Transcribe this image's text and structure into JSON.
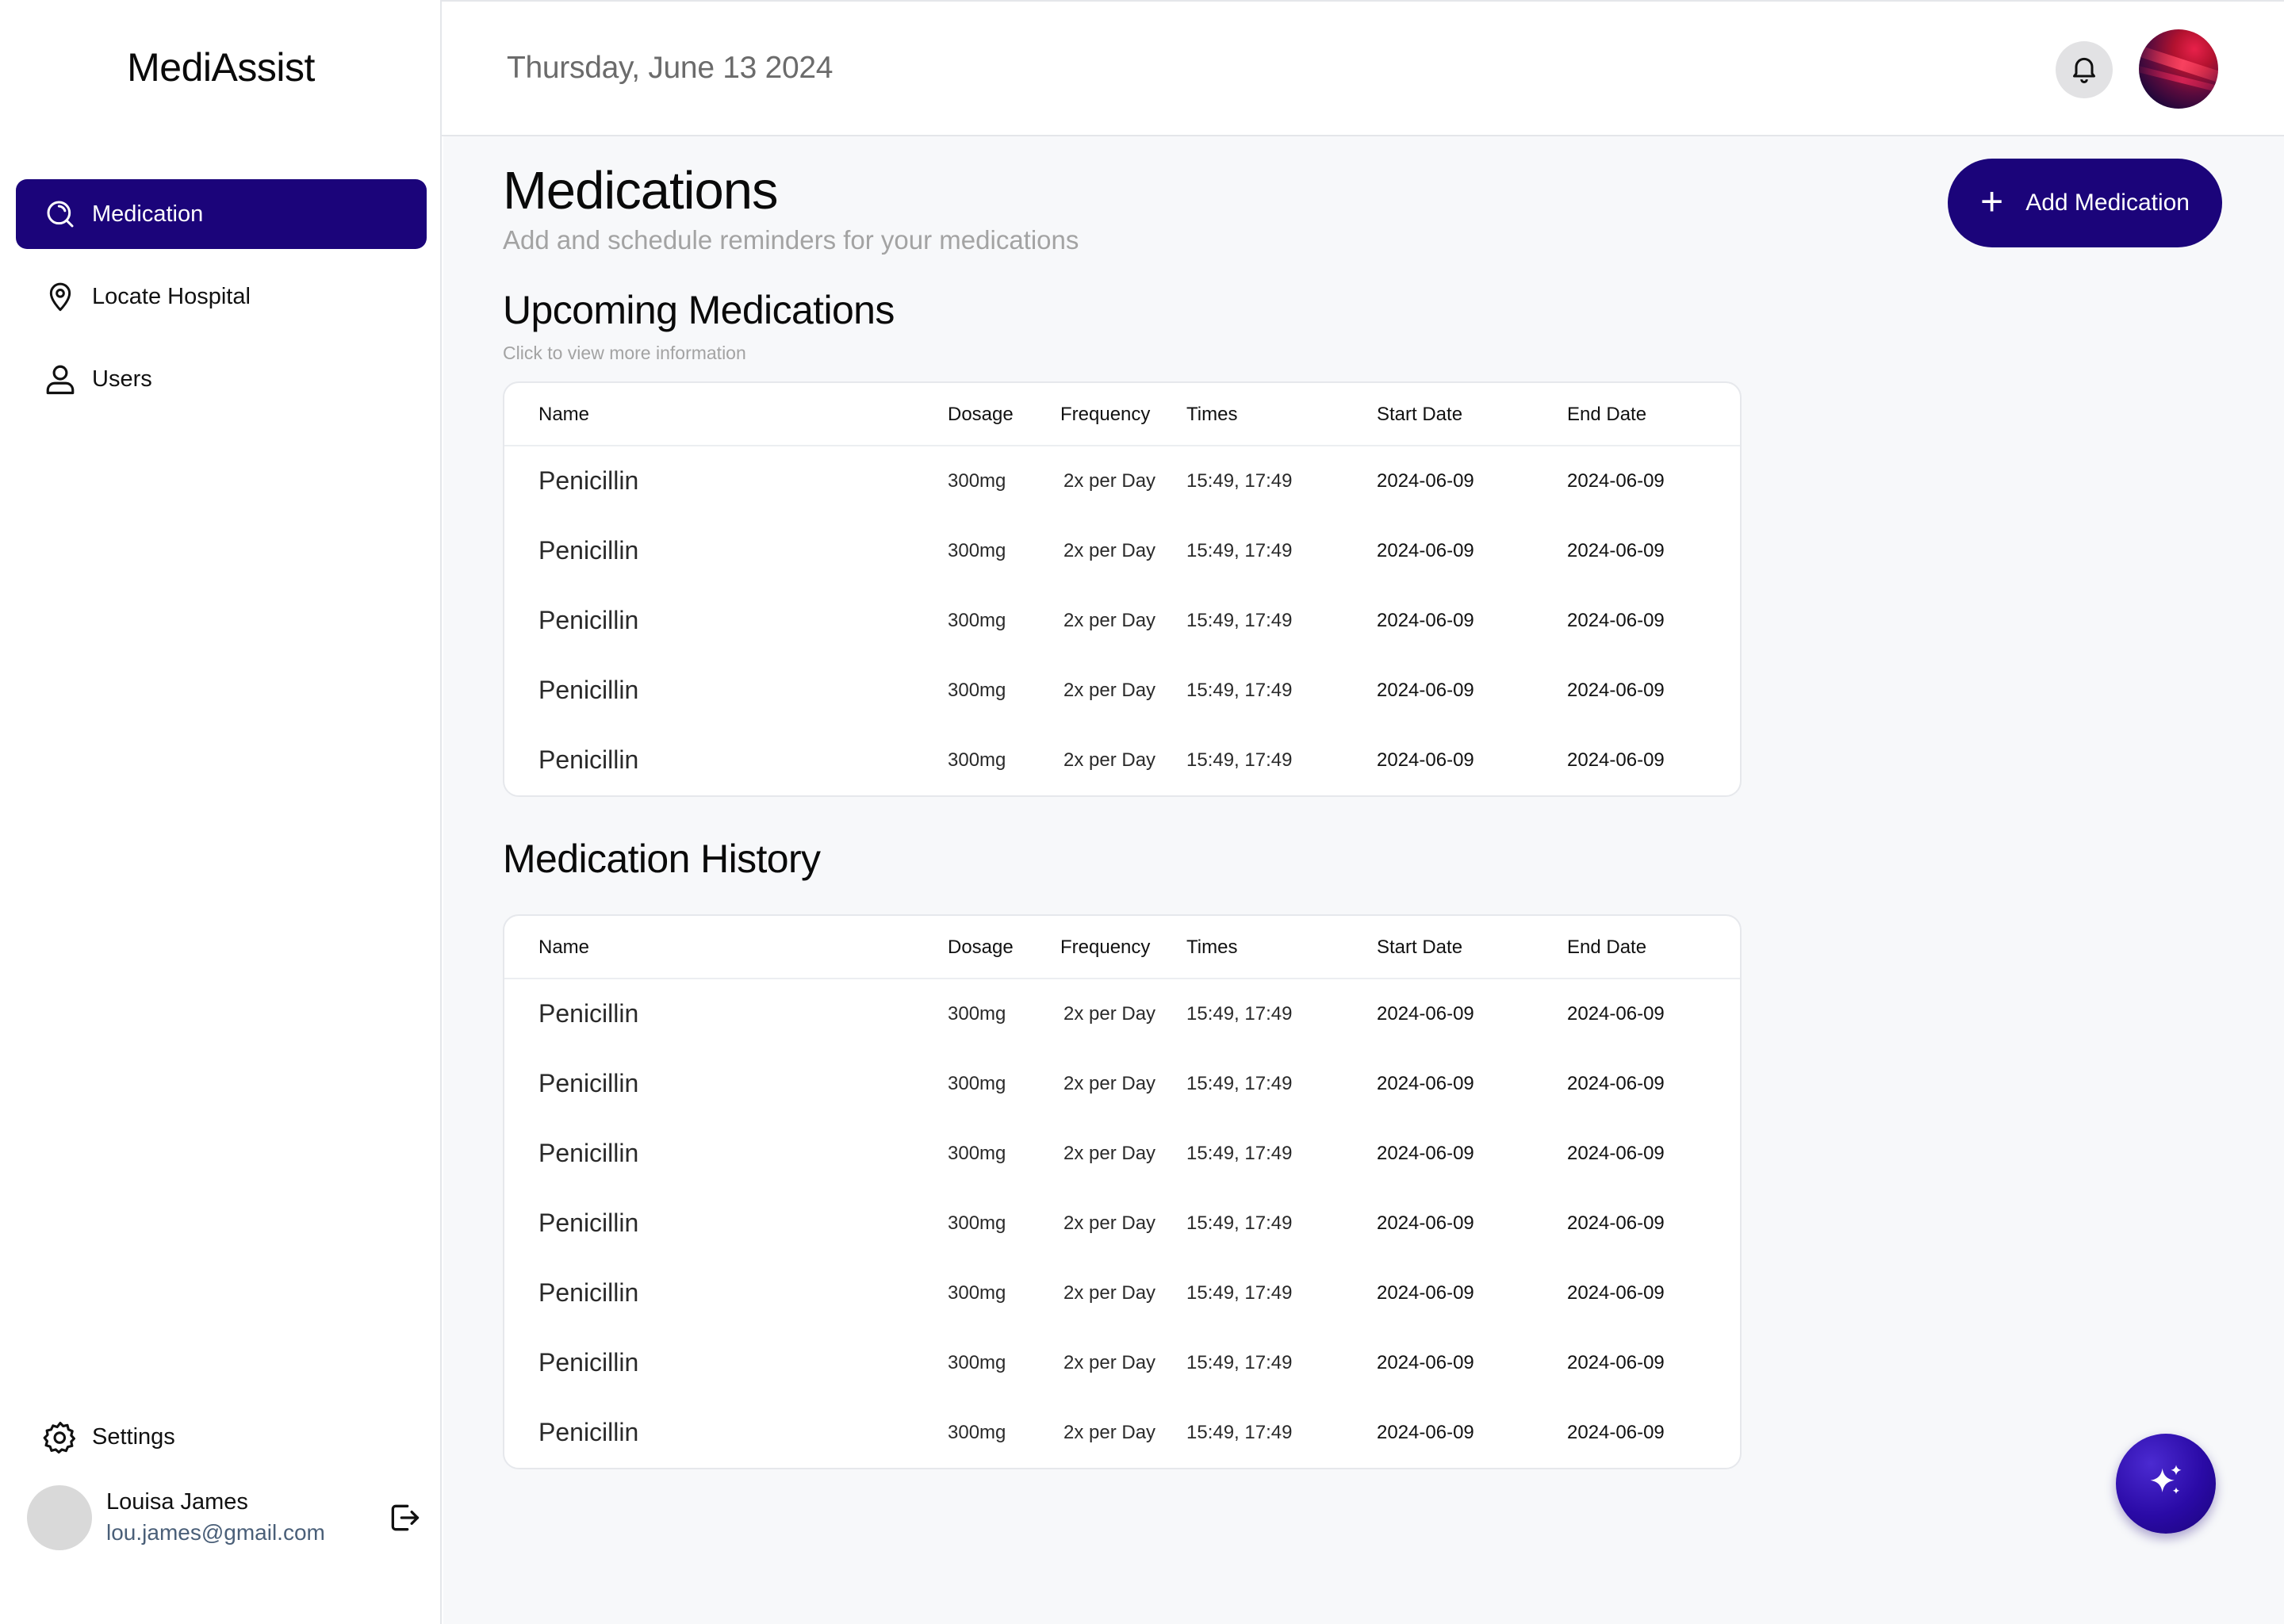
{
  "app": {
    "name": "MediAssist"
  },
  "sidebar": {
    "items": [
      {
        "label": "Medication",
        "icon": "search-icon",
        "active": true
      },
      {
        "label": "Locate Hospital",
        "icon": "location-pin-icon",
        "active": false
      },
      {
        "label": "Users",
        "icon": "user-icon",
        "active": false
      }
    ],
    "settings_label": "Settings"
  },
  "profile": {
    "name": "Louisa James",
    "email": "lou.james@gmail.com"
  },
  "header": {
    "date": "Thursday, June 13 2024"
  },
  "page": {
    "title": "Medications",
    "subtitle": "Add and schedule reminders for your  medications",
    "add_button_label": "Add Medication"
  },
  "upcoming": {
    "title": "Upcoming Medications",
    "hint": "Click to view more information",
    "columns": [
      "Name",
      "Dosage",
      "Frequency",
      "Times",
      "Start Date",
      "End Date"
    ],
    "rows": [
      {
        "name": "Penicillin",
        "dosage": "300mg",
        "frequency": "2x per Day",
        "times": "15:49, 17:49",
        "start": "2024-06-09",
        "end": "2024-06-09"
      },
      {
        "name": "Penicillin",
        "dosage": "300mg",
        "frequency": "2x per Day",
        "times": "15:49, 17:49",
        "start": "2024-06-09",
        "end": "2024-06-09"
      },
      {
        "name": "Penicillin",
        "dosage": "300mg",
        "frequency": "2x per Day",
        "times": "15:49, 17:49",
        "start": "2024-06-09",
        "end": "2024-06-09"
      },
      {
        "name": "Penicillin",
        "dosage": "300mg",
        "frequency": "2x per Day",
        "times": "15:49, 17:49",
        "start": "2024-06-09",
        "end": "2024-06-09"
      },
      {
        "name": "Penicillin",
        "dosage": "300mg",
        "frequency": "2x per Day",
        "times": "15:49, 17:49",
        "start": "2024-06-09",
        "end": "2024-06-09"
      }
    ]
  },
  "history": {
    "title": "Medication History",
    "columns": [
      "Name",
      "Dosage",
      "Frequency",
      "Times",
      "Start Date",
      "End Date"
    ],
    "rows": [
      {
        "name": "Penicillin",
        "dosage": "300mg",
        "frequency": "2x per Day",
        "times": "15:49, 17:49",
        "start": "2024-06-09",
        "end": "2024-06-09"
      },
      {
        "name": "Penicillin",
        "dosage": "300mg",
        "frequency": "2x per Day",
        "times": "15:49, 17:49",
        "start": "2024-06-09",
        "end": "2024-06-09"
      },
      {
        "name": "Penicillin",
        "dosage": "300mg",
        "frequency": "2x per Day",
        "times": "15:49, 17:49",
        "start": "2024-06-09",
        "end": "2024-06-09"
      },
      {
        "name": "Penicillin",
        "dosage": "300mg",
        "frequency": "2x per Day",
        "times": "15:49, 17:49",
        "start": "2024-06-09",
        "end": "2024-06-09"
      },
      {
        "name": "Penicillin",
        "dosage": "300mg",
        "frequency": "2x per Day",
        "times": "15:49, 17:49",
        "start": "2024-06-09",
        "end": "2024-06-09"
      },
      {
        "name": "Penicillin",
        "dosage": "300mg",
        "frequency": "2x per Day",
        "times": "15:49, 17:49",
        "start": "2024-06-09",
        "end": "2024-06-09"
      },
      {
        "name": "Penicillin",
        "dosage": "300mg",
        "frequency": "2x per Day",
        "times": "15:49, 17:49",
        "start": "2024-06-09",
        "end": "2024-06-09"
      }
    ]
  },
  "icons": {
    "notifications": "bell-icon",
    "logout": "logout-icon",
    "settings": "gear-icon",
    "assistant": "sparkle-icon"
  },
  "colors": {
    "accent": "#1b047a",
    "background": "#f7f8fa",
    "muted_text": "#a3a3a3",
    "email_text": "#4a5f78"
  }
}
